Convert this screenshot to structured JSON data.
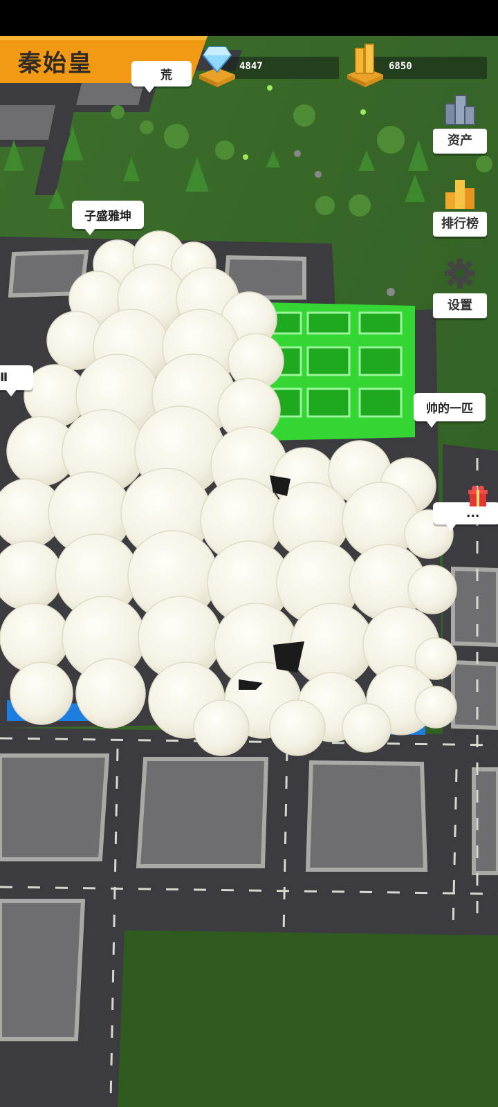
{
  "hud": {
    "player_name": "秦始皇",
    "diamonds": "4847",
    "gold": "6850",
    "diamond_icon": "diamond-icon",
    "gold_icon": "gold-bars-icon"
  },
  "side_buttons": [
    {
      "label": "资产",
      "icon": "assets-icon"
    },
    {
      "label": "排行榜",
      "icon": "leaderboard-icon"
    },
    {
      "label": "设置",
      "icon": "gear-icon"
    }
  ],
  "map_tags": [
    {
      "text": "荒"
    },
    {
      "text": "子盛雅坤"
    },
    {
      "text": "帅的一匹"
    },
    {
      "text": "..."
    }
  ],
  "colors": {
    "grass": "#3a6a2a",
    "road": "#3b3b40",
    "lot": "#6e6e70",
    "highlight": "#3aef3a",
    "banner": "#f39a14"
  }
}
